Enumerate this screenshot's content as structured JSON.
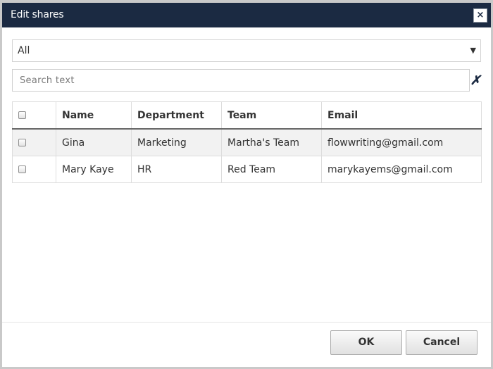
{
  "dialog": {
    "title": "Edit shares",
    "close_label": "×"
  },
  "filter": {
    "selected": "All",
    "arrow": "▼"
  },
  "search": {
    "placeholder": "Search text",
    "value": "",
    "clear_label": "✗"
  },
  "table": {
    "headers": [
      "Name",
      "Department",
      "Team",
      "Email"
    ],
    "rows": [
      {
        "name": "Gina",
        "department": "Marketing",
        "team": "Martha's Team",
        "email": "flowwriting@gmail.com",
        "checked": false
      },
      {
        "name": "Mary Kaye",
        "department": "HR",
        "team": "Red Team",
        "email": "marykayems@gmail.com",
        "checked": false
      }
    ]
  },
  "buttons": {
    "ok": "OK",
    "cancel": "Cancel"
  }
}
